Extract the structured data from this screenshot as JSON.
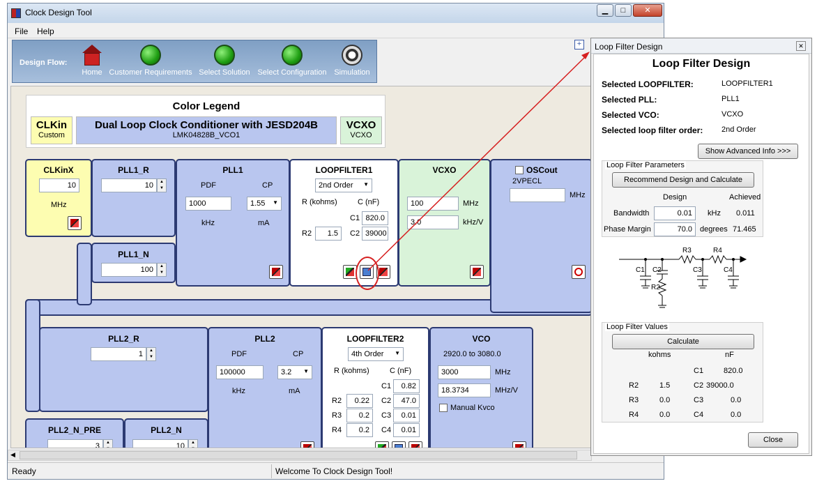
{
  "window": {
    "title": "Clock Design Tool",
    "min": "▁",
    "max": "□",
    "close": "✕"
  },
  "menu": {
    "file": "File",
    "help": "Help"
  },
  "flow": {
    "label": "Design Flow:",
    "items": [
      "Home",
      "Customer Requirements",
      "Select Solution",
      "Select Configuration",
      "Simulation"
    ]
  },
  "legend": {
    "title": "Color Legend",
    "clkin": "CLKin",
    "clkin_sub": "Custom",
    "main": "Dual Loop Clock Conditioner with JESD204B",
    "main_sub": "LMK04828B_VCO1",
    "vcxo": "VCXO",
    "vcxo_sub": "VCXO"
  },
  "clkinx": {
    "title": "CLKinX",
    "value": "10",
    "unit": "MHz"
  },
  "pll1_r": {
    "title": "PLL1_R",
    "value": "10"
  },
  "pll1_n": {
    "title": "PLL1_N",
    "value": "100"
  },
  "pll1": {
    "title": "PLL1",
    "pdf_label": "PDF",
    "cp_label": "CP",
    "pdf": "1000",
    "cp": "1.55",
    "pdf_unit": "kHz",
    "cp_unit": "mA"
  },
  "lf1": {
    "title": "LOOPFILTER1",
    "order": "2nd Order",
    "r_head": "R (kohms)",
    "c_head": "C (nF)",
    "c1_label": "C1",
    "c1": "820.0",
    "r2_label": "R2",
    "r2": "1.5",
    "c2_label": "C2",
    "c2": "39000"
  },
  "vcxo": {
    "title": "VCXO",
    "freq": "100",
    "freq_unit": "MHz",
    "gain": "3.0",
    "gain_unit": "kHz/V"
  },
  "oscout": {
    "title": "OSCout",
    "format": "2VPECL",
    "value": "",
    "unit": "MHz"
  },
  "pll2_r": {
    "title": "PLL2_R",
    "value": "1"
  },
  "pll2": {
    "title": "PLL2",
    "pdf_label": "PDF",
    "cp_label": "CP",
    "pdf": "100000",
    "cp": "3.2",
    "pdf_unit": "kHz",
    "cp_unit": "mA"
  },
  "lf2": {
    "title": "LOOPFILTER2",
    "order": "4th Order",
    "r_head": "R (kohms)",
    "c_head": "C (nF)",
    "rows": [
      {
        "rl": "",
        "r": "",
        "cl": "C1",
        "c": "0.82"
      },
      {
        "rl": "R2",
        "r": "0.22",
        "cl": "C2",
        "c": "47.0"
      },
      {
        "rl": "R3",
        "r": "0.2",
        "cl": "C3",
        "c": "0.01"
      },
      {
        "rl": "R4",
        "r": "0.2",
        "cl": "C4",
        "c": "0.01"
      }
    ]
  },
  "vco": {
    "title": "VCO",
    "range": "2920.0 to 3080.0",
    "freq": "3000",
    "freq_unit": "MHz",
    "gain": "18.3734",
    "gain_unit": "MHz/V",
    "manual": "Manual Kvco"
  },
  "pll2_n_pre": {
    "title": "PLL2_N_PRE",
    "value": "3"
  },
  "pll2_n": {
    "title": "PLL2_N",
    "value": "10"
  },
  "status": {
    "left": "Ready",
    "right": "Welcome To Clock Design Tool!"
  },
  "dialog": {
    "title": "Loop Filter Design",
    "heading": "Loop Filter Design",
    "sel_lf_label": "Selected LOOPFILTER:",
    "sel_lf": "LOOPFILTER1",
    "sel_pll_label": "Selected PLL:",
    "sel_pll": "PLL1",
    "sel_vco_label": "Selected VCO:",
    "sel_vco": "VCXO",
    "sel_order_label": "Selected loop filter order:",
    "sel_order": "2nd Order",
    "adv_btn": "Show Advanced Info >>>",
    "params_title": "Loop Filter Parameters",
    "recommend_btn": "Recommend Design and Calculate",
    "design_head": "Design",
    "achieved_head": "Achieved",
    "bw_label": "Bandwidth",
    "bw": "0.01",
    "bw_unit": "kHz",
    "bw_ach": "0.011",
    "pm_label": "Phase Margin",
    "pm": "70.0",
    "pm_unit": "degrees",
    "pm_ach": "71.465",
    "sch": {
      "r3": "R3",
      "r4": "R4",
      "c1": "C1",
      "c2": "C2",
      "c3": "C3",
      "c4": "C4",
      "r2": "R2"
    },
    "values_title": "Loop Filter Values",
    "calc_btn": "Calculate",
    "kohms": "kohms",
    "nf": "nF",
    "vals": [
      {
        "rl": "",
        "r": "",
        "cl": "C1",
        "c": "820.0"
      },
      {
        "rl": "R2",
        "r": "1.5",
        "cl": "C2",
        "c": "39000.0"
      },
      {
        "rl": "R3",
        "r": "0.0",
        "cl": "C3",
        "c": "0.0"
      },
      {
        "rl": "R4",
        "r": "0.0",
        "cl": "C4",
        "c": "0.0"
      }
    ],
    "close_btn": "Close"
  }
}
